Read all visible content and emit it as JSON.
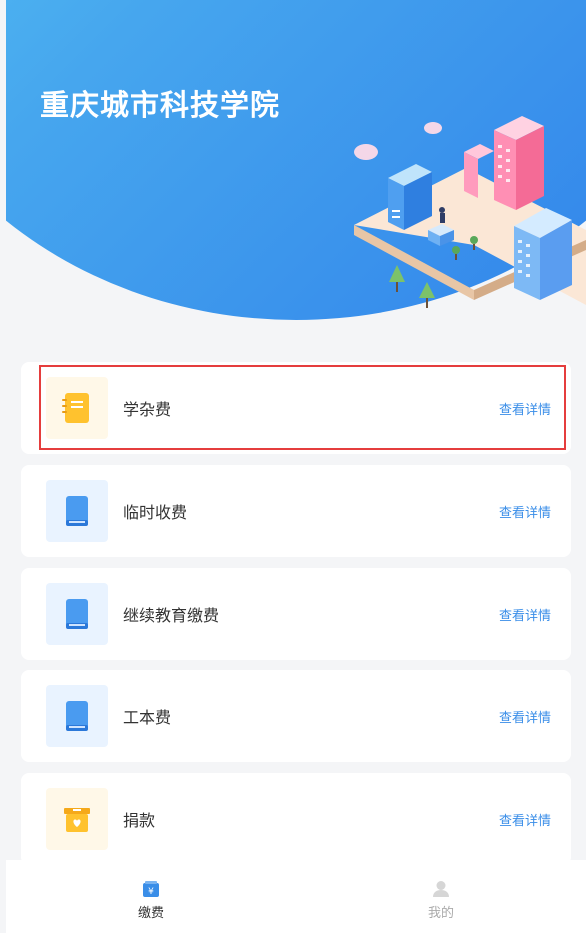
{
  "header": {
    "title": "重庆城市科技学院"
  },
  "fees": [
    {
      "label": "学杂费",
      "detail": "查看详情",
      "icon": "notebook-icon",
      "tone": "yellow"
    },
    {
      "label": "临时收费",
      "detail": "查看详情",
      "icon": "book-icon",
      "tone": "blue"
    },
    {
      "label": "继续教育缴费",
      "detail": "查看详情",
      "icon": "book-icon",
      "tone": "blue"
    },
    {
      "label": "工本费",
      "detail": "查看详情",
      "icon": "book-icon",
      "tone": "blue"
    },
    {
      "label": "捐款",
      "detail": "查看详情",
      "icon": "donation-box-icon",
      "tone": "yellow"
    }
  ],
  "tabbar": {
    "pay": {
      "label": "缴费",
      "icon": "payment-icon",
      "active": true
    },
    "mine": {
      "label": "我的",
      "icon": "user-icon",
      "active": false
    }
  },
  "colors": {
    "accent": "#3a8ee8",
    "highlight": "#e53d3d",
    "yellow": "#ffc22e",
    "blue": "#4a9bf0"
  }
}
